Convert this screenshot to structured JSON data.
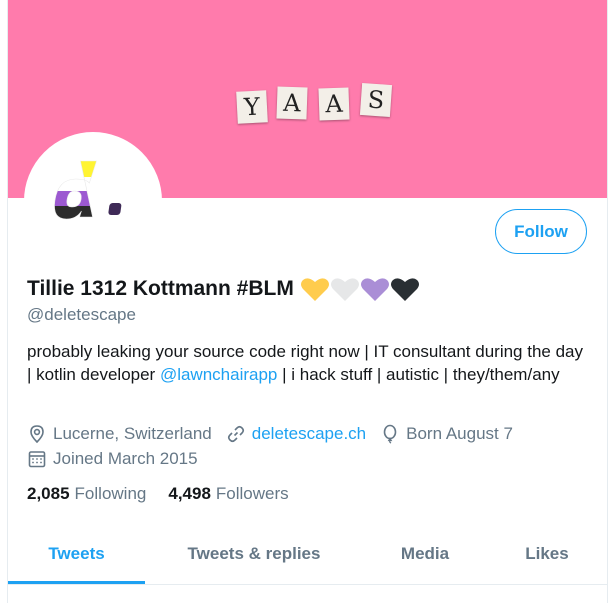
{
  "banner": {
    "letters": [
      "Y",
      "A",
      "A",
      "S"
    ]
  },
  "profile": {
    "name": "Tillie 1312 Kottmann #BLM",
    "handle": "@deletescape",
    "heart_colors": [
      "#ffcc4d",
      "#e6e7e8",
      "#aa8ed6",
      "#292f33"
    ],
    "follow_label": "Follow"
  },
  "bio": {
    "part1": "probably leaking your source code right now  | IT consultant during the day | kotlin developer ",
    "mention": "@lawnchairapp",
    "part2": " | i hack stuff | autistic | they/them/any"
  },
  "meta": {
    "location": "Lucerne, Switzerland",
    "website": "deletescape.ch",
    "birthday": "Born August 7",
    "joined": "Joined March 2015"
  },
  "stats": {
    "following_count": "2,085",
    "following_label": "Following",
    "followers_count": "4,498",
    "followers_label": "Followers"
  },
  "tabs": [
    {
      "label": "Tweets",
      "active": true
    },
    {
      "label": "Tweets & replies",
      "active": false
    },
    {
      "label": "Media",
      "active": false
    },
    {
      "label": "Likes",
      "active": false
    }
  ],
  "colors": {
    "banner": "#ff7bac",
    "accent": "#1da1f2",
    "secondary_text": "#657786"
  }
}
